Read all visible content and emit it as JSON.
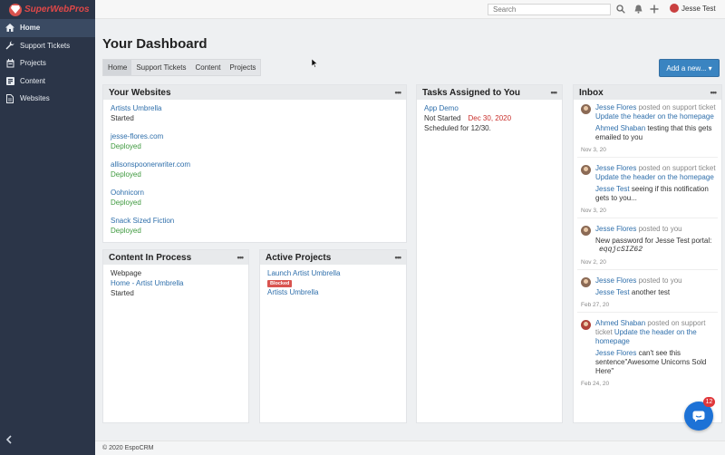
{
  "brand": {
    "name": "SuperWebPros"
  },
  "header": {
    "search_placeholder": "Search",
    "user_name": "Jesse Test",
    "icons": [
      "search-icon",
      "bell-icon",
      "plus-icon",
      "user-avatar"
    ]
  },
  "sidebar": {
    "items": [
      {
        "label": "Home",
        "icon": "home-icon",
        "active": true
      },
      {
        "label": "Support Tickets",
        "icon": "wrench-icon"
      },
      {
        "label": "Projects",
        "icon": "calendar-icon"
      },
      {
        "label": "Content",
        "icon": "content-icon"
      },
      {
        "label": "Websites",
        "icon": "document-icon"
      }
    ]
  },
  "main": {
    "title": "Your Dashboard",
    "tabs": [
      "Home",
      "Support Tickets",
      "Content",
      "Projects"
    ],
    "add_button": "Add a new... ▾"
  },
  "websites": {
    "title": "Your Websites",
    "items": [
      {
        "name": "Artists Umbrella",
        "status": "Started"
      },
      {
        "name": "jesse-flores.com",
        "status": "Deployed"
      },
      {
        "name": "allisonspoonerwriter.com",
        "status": "Deployed"
      },
      {
        "name": "Oohnicorn",
        "status": "Deployed"
      },
      {
        "name": "Snack Sized Fiction",
        "status": "Deployed"
      }
    ]
  },
  "tasks": {
    "title": "Tasks Assigned to You",
    "item": {
      "name": "App Demo",
      "status": "Not Started",
      "date": "Dec 30, 2020",
      "note": "Scheduled for 12/30."
    }
  },
  "content_in_process": {
    "title": "Content In Process",
    "type": "Webpage",
    "name": "Home - Artist Umbrella",
    "status": "Started"
  },
  "active_projects": {
    "title": "Active Projects",
    "project": "Launch Artist Umbrella",
    "badge": "Blocked",
    "parent": "Artists Umbrella"
  },
  "inbox": {
    "title": "Inbox",
    "items": [
      {
        "author": "Jesse Flores",
        "action": "posted on support ticket",
        "subject": "Update the header on the homepage",
        "reply_author": "Ahmed Shaban",
        "reply": "testing that this gets emailed to you",
        "date": "Nov 3, 20"
      },
      {
        "author": "Jesse Flores",
        "action": "posted on support ticket",
        "subject": "Update the header on the homepage",
        "reply_author": "Jesse Test",
        "reply": "seeing if this notification gets to you...",
        "date": "Nov 3, 20"
      },
      {
        "author": "Jesse Flores",
        "action": "posted to you",
        "message": "New password for Jesse Test portal:",
        "code": "eqqjcSIZ62",
        "date": "Nov 2, 20"
      },
      {
        "author": "Jesse Flores",
        "action": "posted to you",
        "reply_author": "Jesse Test",
        "reply": "another test",
        "date": "Feb 27, 20"
      },
      {
        "author": "Ahmed Shaban",
        "action": "posted on support ticket",
        "subject": "Update the header on the homepage",
        "reply_author": "Jesse Flores",
        "reply": "can't see this sentence\"Awesome Unicorns Sold Here\"",
        "date": "Feb 24, 20"
      }
    ]
  },
  "footer": {
    "text": "© 2020 EspoCRM"
  },
  "chat": {
    "badge": "12"
  },
  "colors": {
    "sidebar": "#2b3548",
    "brand": "#e04848",
    "link": "#2f6fab",
    "deployed": "#3f9a3f",
    "primary_button": "#3a84c1",
    "blocked": "#d9534f",
    "chat": "#1d72d6"
  }
}
